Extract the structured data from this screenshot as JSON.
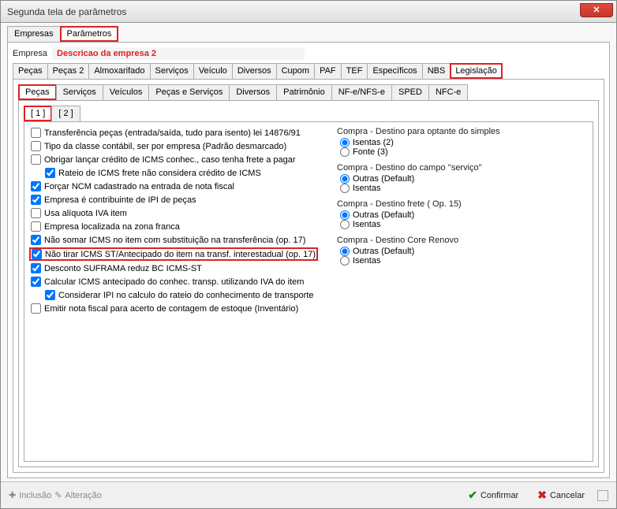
{
  "window_title": "Segunda tela de parâmetros",
  "tabs_main": {
    "empresas": "Empresas",
    "parametros": "Parâmetros"
  },
  "empresa": {
    "label": "Empresa",
    "desc": "Descricao da empresa 2"
  },
  "tabs_cat": {
    "pecas": "Peças",
    "pecas2": "Peças 2",
    "almox": "Almoxarifado",
    "servicos": "Serviços",
    "veiculo": "Veículo",
    "diversos": "Diversos",
    "cupom": "Cupom",
    "paf": "PAF",
    "tef": "TEF",
    "especificos": "Específicos",
    "nbs": "NBS",
    "legislacao": "Legislação"
  },
  "tabs_legis": {
    "pecas": "Peças",
    "servicos": "Serviços",
    "veiculos": "Veículos",
    "pecserv": "Peças e Serviços",
    "diversos": "Diversos",
    "patrimonio": "Patrimônio",
    "nfe": "NF-e/NFS-e",
    "sped": "SPED",
    "nfce": "NFC-e"
  },
  "tabs_pecas": {
    "p1": "[ 1 ]",
    "p2": "[ 2 ]"
  },
  "checks": {
    "c0": "Transferência peças (entrada/saída, tudo para isento) lei 14876/91",
    "c1": "Tipo da classe contábil, ser por empresa (Padrão desmarcado)",
    "c2": "Obrigar lançar crédito de ICMS conhec., caso tenha frete a pagar",
    "c2a": "Rateio de ICMS frete não considera crédito de ICMS",
    "c3": "Forçar NCM cadastrado na entrada de nota fiscal",
    "c4": "Empresa é contribuinte de IPI de peças",
    "c5": "Usa alíquota IVA item",
    "c6": "Empresa localizada na zona franca",
    "c7": "Não somar ICMS no item com substituição na transferência (op. 17)",
    "c8": "Não tirar ICMS ST/Antecipado do item na transf. interestadual (op. 17)",
    "c9": "Desconto SUFRAMA reduz BC ICMS-ST",
    "c10": "Calcular ICMS antecipado do conhec. transp. utilizando IVA do item",
    "c10a": "Considerar IPI no calculo do rateio do conhecimento de transporte",
    "c11": "Emitir nota fiscal para acerto de contagem de estoque (Inventário)"
  },
  "groups": {
    "g1": {
      "title": "Compra - Destino para optante do simples",
      "o1": "Isentas (2)",
      "o2": "Fonte (3)"
    },
    "g2": {
      "title": "Compra - Destino do campo ''serviço''",
      "o1": "Outras (Default)",
      "o2": "Isentas"
    },
    "g3": {
      "title": "Compra - Destino frete ( Op. 15)",
      "o1": "Outras (Default)",
      "o2": "Isentas"
    },
    "g4": {
      "title": "Compra - Destino Core Renovo",
      "o1": "Outras (Default)",
      "o2": "Isentas"
    }
  },
  "footer": {
    "inclusao": "Inclusão",
    "alteracao": "Alteração",
    "confirmar": "Confirmar",
    "cancelar": "Cancelar"
  }
}
